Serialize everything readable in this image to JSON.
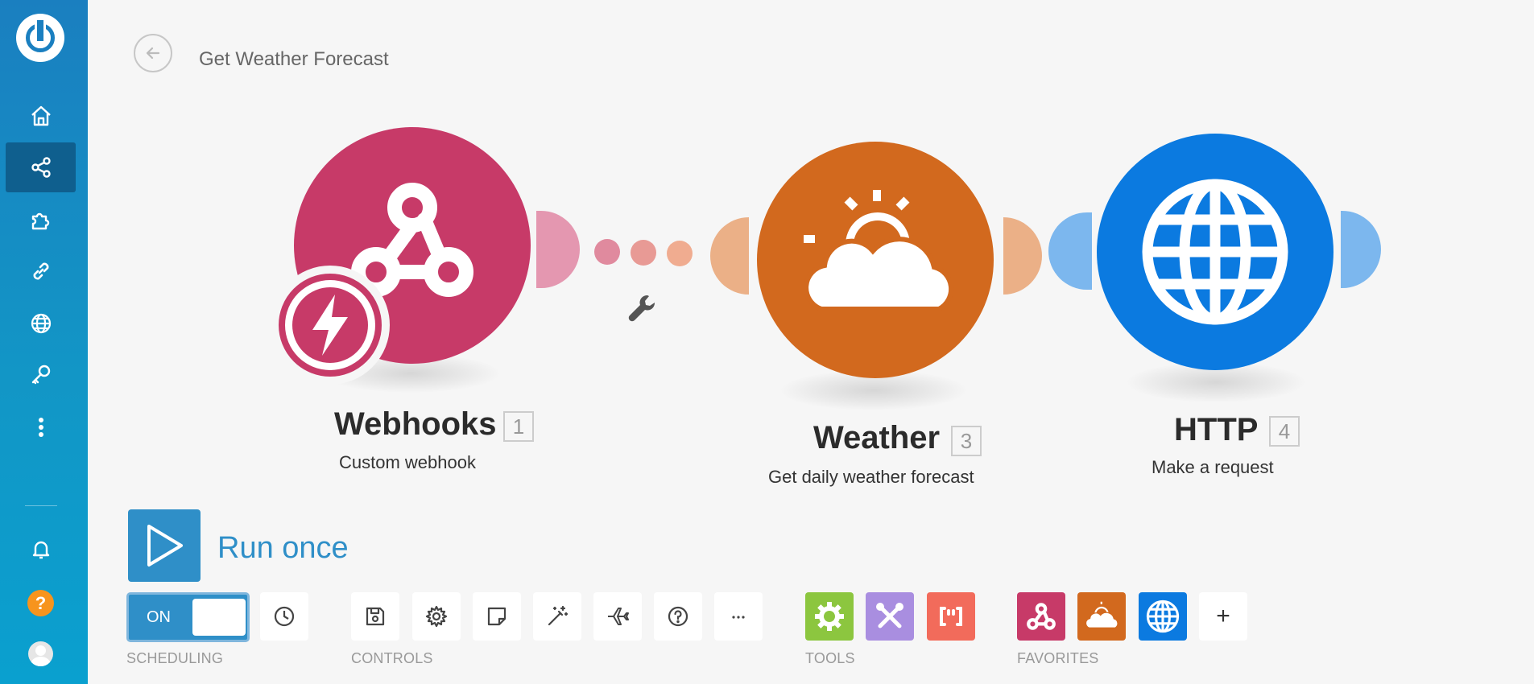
{
  "sidebar": {
    "items": [
      {
        "name": "home-icon",
        "active": false
      },
      {
        "name": "share-icon",
        "active": true
      },
      {
        "name": "puzzle-icon",
        "active": false
      },
      {
        "name": "link-icon",
        "active": false
      },
      {
        "name": "globe-icon",
        "active": false
      },
      {
        "name": "key-icon",
        "active": false
      },
      {
        "name": "more-vertical-icon",
        "active": false
      }
    ],
    "help_label": "?"
  },
  "header": {
    "title": "Get Weather Forecast"
  },
  "modules": [
    {
      "name": "Webhooks",
      "number": "1",
      "subtitle": "Custom webhook",
      "color": "#c73a68",
      "icon": "webhook-icon"
    },
    {
      "name": "Weather",
      "number": "3",
      "subtitle": "Get daily weather forecast",
      "color": "#d2691e",
      "icon": "weather-icon"
    },
    {
      "name": "HTTP",
      "number": "4",
      "subtitle": "Make a request",
      "color": "#0b7ae0",
      "icon": "globe-icon"
    }
  ],
  "run": {
    "label": "Run once"
  },
  "scheduling": {
    "toggle_label": "ON",
    "section_label": "SCHEDULING"
  },
  "controls": {
    "section_label": "CONTROLS",
    "buttons": [
      "save-icon",
      "gear-icon",
      "note-icon",
      "magic-wand-icon",
      "airplane-icon",
      "help-circle-icon",
      "more-horizontal-icon"
    ],
    "more_label": "..."
  },
  "tools": {
    "section_label": "TOOLS",
    "items": [
      {
        "icon": "gear-icon",
        "color": "#8cc63f"
      },
      {
        "icon": "tools-icon",
        "color": "#a98ee0"
      },
      {
        "icon": "brackets-icon",
        "color": "#f26b5b"
      }
    ]
  },
  "favorites": {
    "section_label": "FAVORITES",
    "items": [
      {
        "icon": "webhook-icon",
        "color": "#c73a68"
      },
      {
        "icon": "weather-icon",
        "color": "#d2691e"
      },
      {
        "icon": "globe-icon",
        "color": "#0b7ae0"
      }
    ],
    "add_label": "+"
  }
}
